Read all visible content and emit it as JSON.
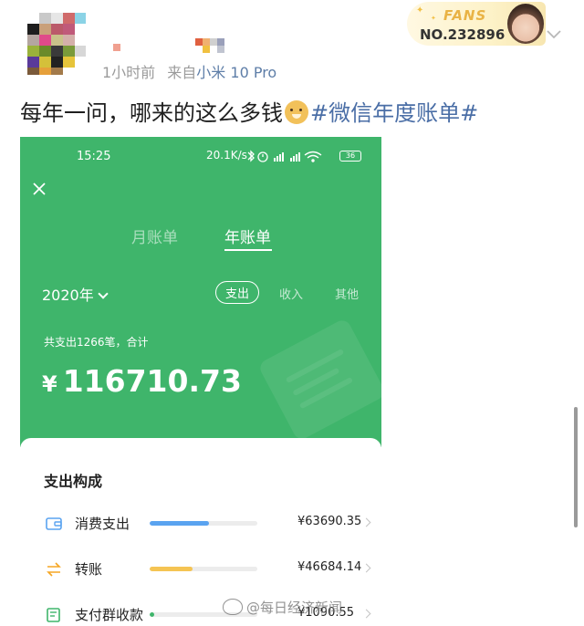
{
  "post": {
    "time_ago": "1小时前",
    "source_prefix": "来自",
    "source_device": "小米 10 Pro",
    "text_main": "每年一问，哪来的这么多钱",
    "hashtag": "#微信年度账单#",
    "emoji_icon": "doge-emoji"
  },
  "fans_badge": {
    "label": "FANS",
    "number": "NO.232896"
  },
  "screenshot": {
    "status_time": "15:25",
    "network_speed": "20.1K/s",
    "battery": "36",
    "tabs": [
      {
        "label": "月账单",
        "active": false
      },
      {
        "label": "年账单",
        "active": true
      }
    ],
    "year": "2020年",
    "filters": [
      {
        "label": "支出",
        "active": true
      },
      {
        "label": "收入",
        "active": false
      },
      {
        "label": "其他",
        "active": false
      }
    ],
    "total_caption": "共支出1266笔，合计",
    "currency_symbol": "¥",
    "total_amount": "116710.73",
    "breakdown": {
      "title": "支出构成",
      "items": [
        {
          "label": "消费支出",
          "amount": "¥63690.35",
          "fraction": 0.55,
          "color": "#5aa3f0",
          "icon": "wallet-icon"
        },
        {
          "label": "转账",
          "amount": "¥46684.14",
          "fraction": 0.4,
          "color": "#f5c453",
          "icon": "transfer-icon"
        },
        {
          "label": "支付群收款",
          "amount": "¥1090.55",
          "fraction": 0.02,
          "color": "#3fb56b",
          "icon": "group-receipt-icon"
        }
      ]
    }
  },
  "watermark": "@每日经济新闻",
  "colors": {
    "wechat_green": "#3fb56b",
    "hashtag_blue": "#4a6ea6",
    "fans_gold": "#e9b345"
  }
}
